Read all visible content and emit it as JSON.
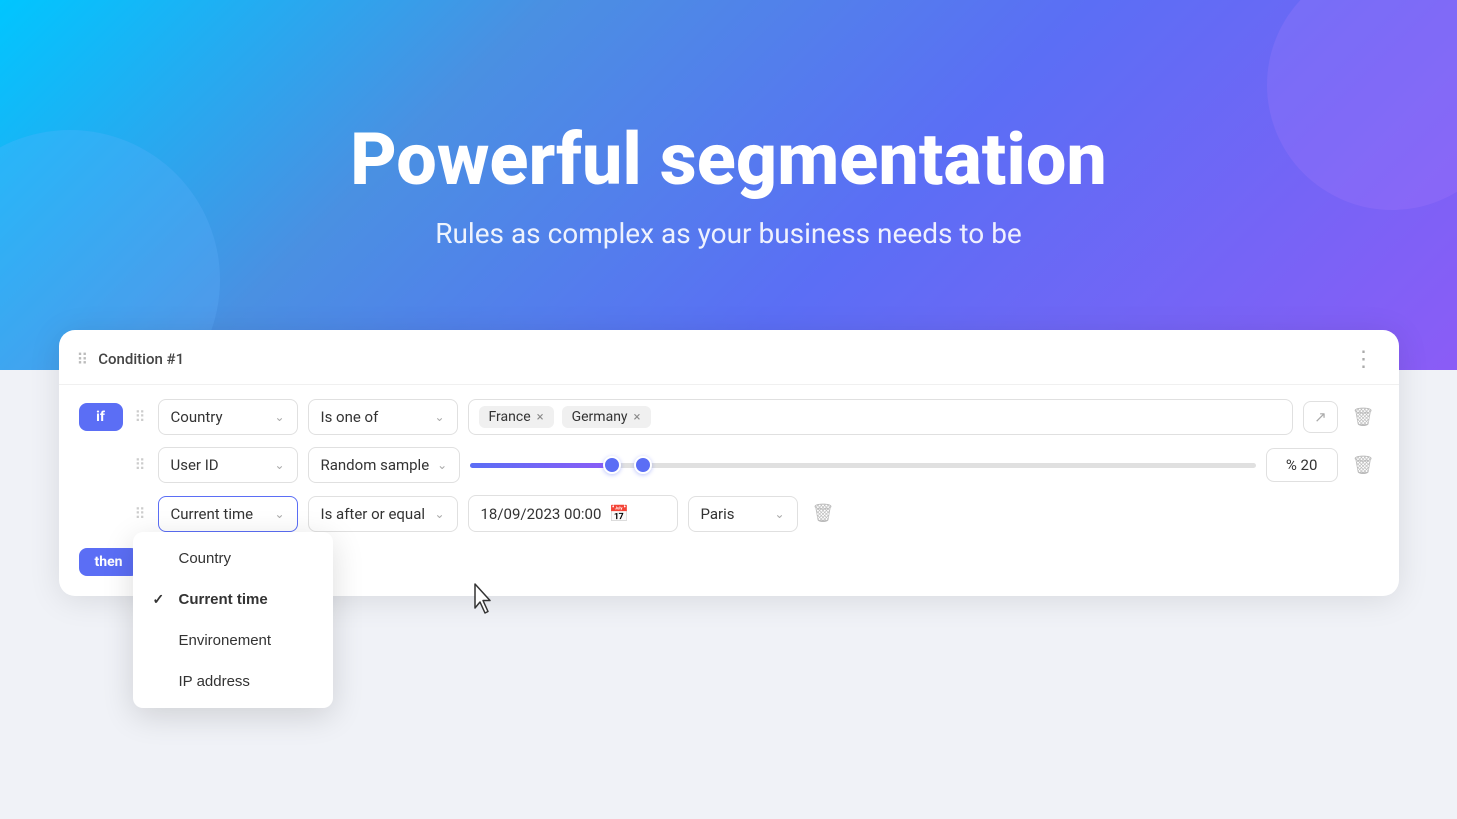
{
  "hero": {
    "title": "Powerful segmentation",
    "subtitle": "Rules as complex as your business needs to be"
  },
  "card": {
    "condition_label": "Condition #1",
    "more_icon": "⋮",
    "drag_icon": "⠿"
  },
  "row1": {
    "if_label": "if",
    "field": "Country",
    "operator": "Is one of",
    "tags": [
      "France",
      "Germany"
    ],
    "expand_icon": "↗"
  },
  "row2": {
    "field": "User ID",
    "operator": "Random sample",
    "percent_value": "% 20"
  },
  "row3": {
    "field": "Current time",
    "operator": "Is after or equal",
    "date_value": "18/09/2023 00:00",
    "timezone": "Paris"
  },
  "dropdown": {
    "items": [
      {
        "label": "Country",
        "selected": false
      },
      {
        "label": "Current time",
        "selected": true
      },
      {
        "label": "Environement",
        "selected": false
      },
      {
        "label": "IP address",
        "selected": false
      }
    ]
  },
  "bottom": {
    "then_label": "then"
  },
  "icons": {
    "drag": "⠿",
    "chevron": "⌃",
    "delete": "🗑",
    "calendar": "📅",
    "check": "✓"
  }
}
